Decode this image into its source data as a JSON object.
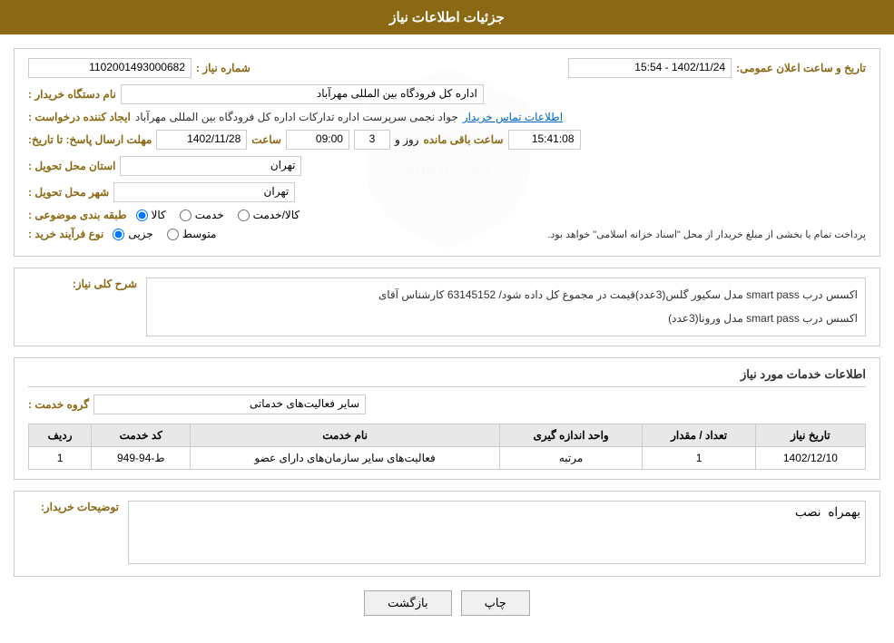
{
  "header": {
    "title": "جزئیات اطلاعات نیاز"
  },
  "form": {
    "shomareNiaz_label": "شماره نیاز :",
    "shomareNiaz_value": "1102001493000682",
    "namDastgah_label": "نام دستگاه خریدار :",
    "namDastgah_value": "اداره کل فرودگاه بین المللی مهرآباد",
    "tarixVaSaat_label": "تاریخ و ساعت اعلان عمومی:",
    "tarixVaSaat_value": "1402/11/24 - 15:54",
    "ijadKonande_label": "ایجاد کننده درخواست :",
    "ijadKonande_value": "جواد نجمی سرپرست اداره تدارکات  اداره کل فرودگاه بین المللی مهرآباد",
    "ettelaatTamas_label": "اطلاعات تماس خریدار",
    "mohlatErsalPasokh_label": "مهلت ارسال پاسخ: تا تاریخ:",
    "mohlatDate_value": "1402/11/28",
    "mohlatSaat_label": "ساعت",
    "mohlatSaat_value": "09:00",
    "mohlatRoz_label": "روز و",
    "mohlatRoz_value": "3",
    "baghimande_label": "ساعت باقی مانده",
    "baghimande_value": "15:41:08",
    "ostanTahvil_label": "استان محل تحویل :",
    "ostanTahvil_value": "تهران",
    "shahrTahvil_label": "شهر محل تحویل :",
    "shahrTahvil_value": "تهران",
    "tabaqeBandi_label": "طبقه بندی موضوعی :",
    "tabaqe_options": [
      "کالا",
      "خدمت",
      "کالا/خدمت"
    ],
    "tabaqe_selected": "کالا",
    "noeFarayand_label": "نوع فرآیند خرید :",
    "noeFarayand_options": [
      "جزیی",
      "متوسط"
    ],
    "noeFarayand_note": "پرداخت تمام یا بخشی از مبلغ خریدار از محل \"اسناد خزانه اسلامی\" خواهد بود.",
    "sharhKolliNiaz_label": "شرح کلی نیاز:",
    "sharhKolli_line1": "اکسس درب smart pass مدل ورونا(3عدد)",
    "sharhKolli_line2": "اکسس درب smart pass مدل سکیور گلس(3عدد)قیمت در مجموع کل داده شود/ 63145152 کارشناس آقای",
    "ettelaatKhadamat_label": "اطلاعات خدمات مورد نیاز",
    "gruhKhadamat_label": "گروه خدمت :",
    "gruhKhadamat_value": "سایر فعالیت‌های خدماتی",
    "table": {
      "cols": [
        "ردیف",
        "کد خدمت",
        "نام خدمت",
        "واحد اندازه گیری",
        "تعداد / مقدار",
        "تاریخ نیاز"
      ],
      "rows": [
        {
          "radif": "1",
          "kodKhadamat": "ط-94-949",
          "namKhadamat": "فعالیت‌های سایر سازمان‌های دارای عضو",
          "vahed": "مرتبه",
          "tedad": "1",
          "tarixNiaz": "1402/12/10"
        }
      ]
    },
    "tozihatKharidar_label": "توضیحات خریدار:",
    "tozihat_placeholder": "بهمراه نصب",
    "backButton": "بازگشت",
    "printButton": "چاپ"
  }
}
